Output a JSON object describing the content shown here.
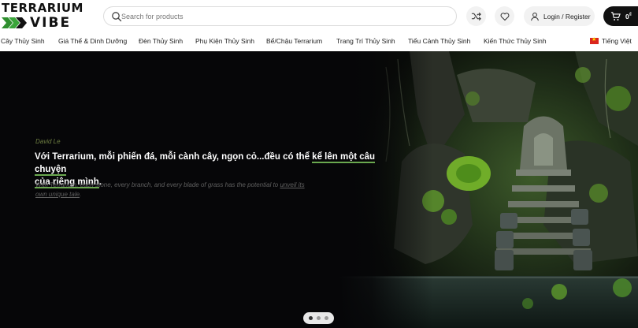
{
  "header": {
    "logo_line1": "TERRARIUM",
    "logo_line2": "VIBE",
    "search_placeholder": "Search for products",
    "login_label": "Login / Register",
    "cart_amount": "0",
    "cart_currency": "₫"
  },
  "nav": {
    "items": [
      "Cây Thủy Sinh",
      "Giá Thể & Dinh Dưỡng",
      "Đèn Thủy Sinh",
      "Phụ Kiện Thủy Sinh",
      "Bể/Chậu Terrarium",
      "Trang Trí Thủy Sinh",
      "Tiểu Cảnh Thủy Sinh",
      "Kiến Thức Thủy Sinh"
    ],
    "language": "Tiếng Việt"
  },
  "hero": {
    "author": "David Le",
    "quote_part1": "Với Terrarium, mỗi phiến đá, mỗi cành cây, ngọn cỏ...đều có thể ",
    "quote_highlight1": "kể lên một câu chuyện",
    "quote_highlight2": "của riêng mình",
    "quote_end": ".",
    "en_part1": "With Terrarium, each stone, every branch, and every blade of grass has the potential to ",
    "en_link1": "unveil its",
    "en_link2": "own unique tale",
    "en_end": "."
  },
  "slider": {
    "count": 3,
    "active": 0
  },
  "colors": {
    "accent_green": "#6aa84f",
    "hero_bg": "#060608",
    "author": "#6f7f42"
  }
}
